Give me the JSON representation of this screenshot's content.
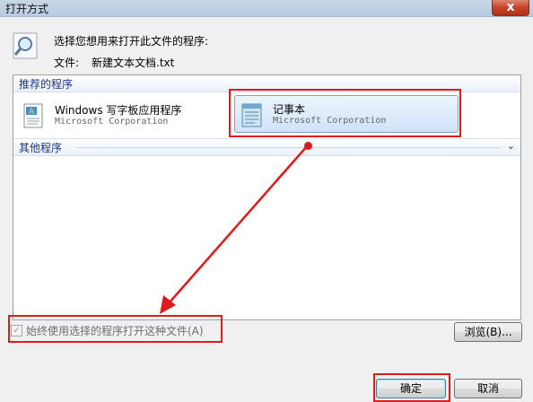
{
  "window": {
    "title": "打开方式",
    "close_glyph": "x"
  },
  "header": {
    "prompt": "选择您想用来打开此文件的程序:",
    "file_label": "文件:",
    "file_name": "新建文本文档.txt"
  },
  "recommended": {
    "heading": "推荐的程序",
    "programs": [
      {
        "name": "Windows 写字板应用程序",
        "company": "Microsoft Corporation",
        "icon": "wordpad-icon"
      },
      {
        "name": "记事本",
        "company": "Microsoft Corporation",
        "icon": "notepad-icon",
        "selected": true
      }
    ]
  },
  "other": {
    "heading": "其他程序",
    "expand_glyph": "⌄"
  },
  "always_use": {
    "label": "始终使用选择的程序打开这种文件(A)",
    "checked": true,
    "enabled": false
  },
  "buttons": {
    "browse": "浏览(B)...",
    "ok": "确定",
    "cancel": "取消"
  },
  "annotation_color": "#e01b1b"
}
